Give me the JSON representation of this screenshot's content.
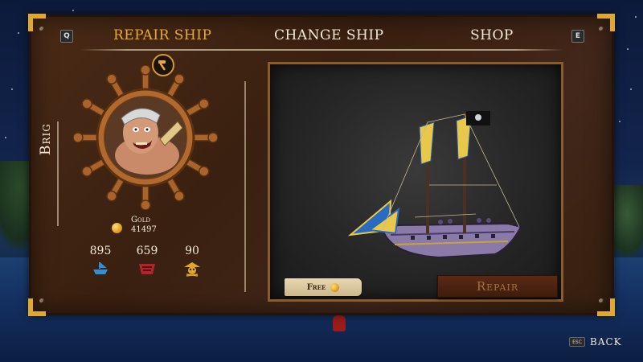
{
  "tabs": [
    {
      "label": "REPAIR SHIP",
      "active": true
    },
    {
      "label": "CHANGE SHIP",
      "active": false
    },
    {
      "label": "SHOP",
      "active": false
    }
  ],
  "key_hints": {
    "prev": "Q",
    "next": "E"
  },
  "ship": {
    "class": "Brig"
  },
  "crew_portrait": {
    "icon": "crew-portrait-icon",
    "badge_icon": "hammer-icon"
  },
  "gold": {
    "label": "Gold",
    "value": "41497"
  },
  "stats": [
    {
      "value": "895",
      "icon": "ship-speed-icon",
      "color": "#2f8fd8"
    },
    {
      "value": "659",
      "icon": "ship-hull-icon",
      "color": "#b0242a"
    },
    {
      "value": "90",
      "icon": "skull-crew-icon",
      "color": "#e0a82a"
    }
  ],
  "repair": {
    "cost_label": "Free",
    "button_label": "Repair"
  },
  "footer": {
    "esc_key": "ESC",
    "back_label": "BACK"
  },
  "colors": {
    "accent": "#e8aa34",
    "panel": "#3a2010",
    "text": "#f3ead6"
  }
}
